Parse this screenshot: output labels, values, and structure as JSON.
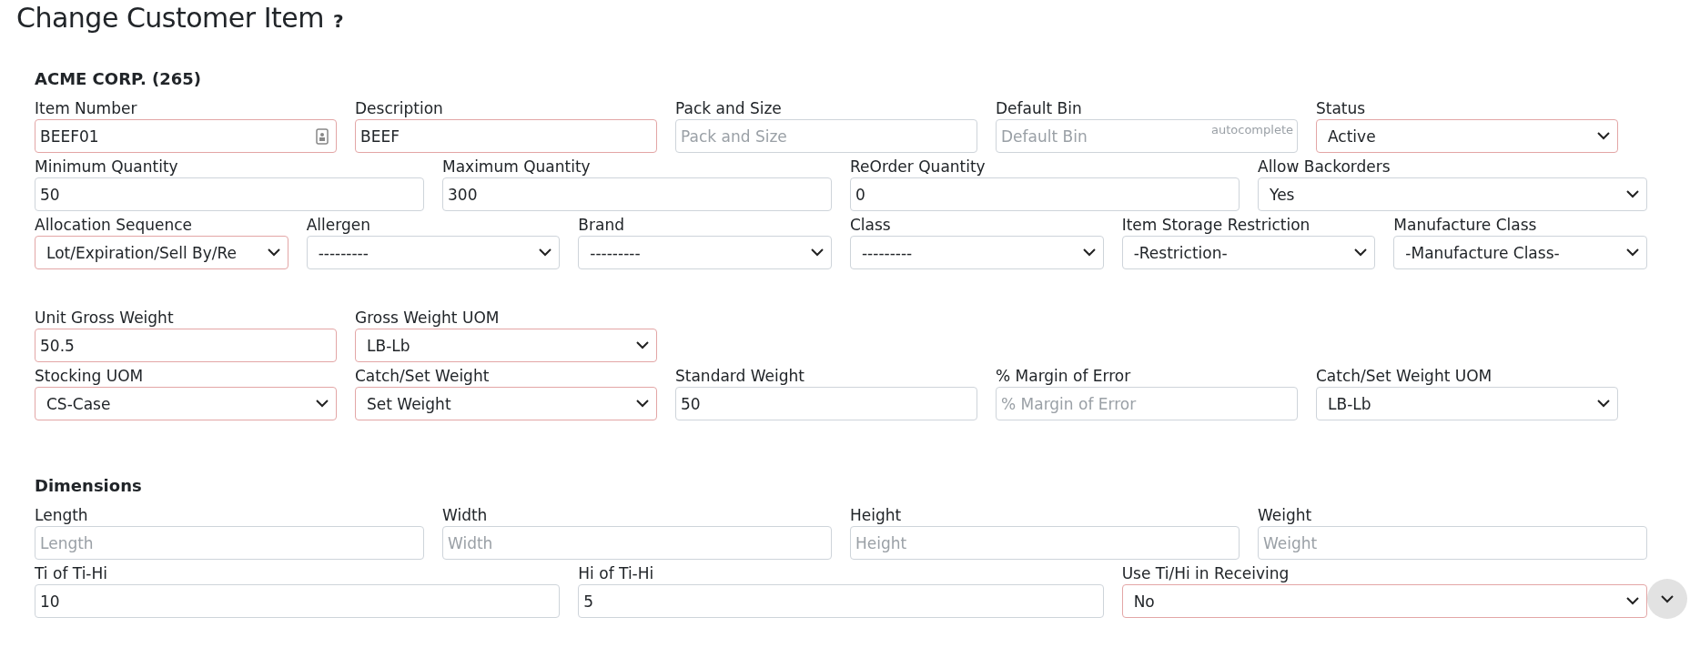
{
  "title": "Change Customer Item",
  "help": "?",
  "customer": "ACME CORP. (265)",
  "item_rows": [
    [
      {
        "label": "Item Number",
        "kind": "text",
        "value": "BEEF01",
        "required": true,
        "icon": true
      },
      {
        "label": "Description",
        "kind": "text",
        "value": "BEEF",
        "required": true
      },
      {
        "label": "Pack and Size",
        "kind": "text",
        "placeholder": "Pack and Size",
        "required": false
      },
      {
        "label": "Default Bin",
        "kind": "text",
        "placeholder": "Default Bin",
        "hint": "autocomplete",
        "required": false
      },
      {
        "label": "Status",
        "kind": "select",
        "value": "Active",
        "required": true
      }
    ],
    [
      {
        "label": "Minimum Quantity",
        "kind": "text",
        "value": "50",
        "required": false
      },
      {
        "label": "Maximum Quantity",
        "kind": "text",
        "value": "300",
        "required": false
      },
      {
        "label": "ReOrder Quantity",
        "kind": "text",
        "value": "0",
        "required": false
      },
      {
        "label": "Allow Backorders",
        "kind": "select",
        "value": "Yes",
        "required": false
      }
    ],
    [
      {
        "label": "Allocation Sequence",
        "kind": "select",
        "value": "Lot/Expiration/Sell By/Re",
        "required": true
      },
      {
        "label": "Allergen",
        "kind": "select",
        "value": "---------",
        "required": false
      },
      {
        "label": "Brand",
        "kind": "select",
        "value": "---------",
        "required": false
      },
      {
        "label": "Class",
        "kind": "select",
        "value": "---------",
        "required": false
      },
      {
        "label": "Item Storage Restriction",
        "kind": "select",
        "value": "-Restriction-",
        "required": false
      },
      {
        "label": "Manufacture Class",
        "kind": "select",
        "value": "-Manufacture Class-",
        "required": false
      }
    ]
  ],
  "weight_rows": [
    [
      {
        "label": "Unit Gross Weight",
        "kind": "text",
        "value": "50.5",
        "required": true
      },
      {
        "label": "Gross Weight UOM",
        "kind": "select",
        "value": "LB-Lb",
        "required": true
      }
    ],
    [
      {
        "label": "Stocking UOM",
        "kind": "select",
        "value": "CS-Case",
        "required": true
      },
      {
        "label": "Catch/Set Weight",
        "kind": "select",
        "value": "Set Weight",
        "required": true
      },
      {
        "label": "Standard Weight",
        "kind": "text",
        "value": "50",
        "required": false
      },
      {
        "label": "% Margin of Error",
        "kind": "text",
        "placeholder": "% Margin of Error",
        "required": false
      },
      {
        "label": "Catch/Set Weight UOM",
        "kind": "select",
        "value": "LB-Lb",
        "required": false
      }
    ]
  ],
  "dimensions": {
    "heading": "Dimensions",
    "rows": [
      [
        {
          "label": "Length",
          "kind": "text",
          "placeholder": "Length",
          "required": false
        },
        {
          "label": "Width",
          "kind": "text",
          "placeholder": "Width",
          "required": false
        },
        {
          "label": "Height",
          "kind": "text",
          "placeholder": "Height",
          "required": false
        },
        {
          "label": "Weight",
          "kind": "text",
          "placeholder": "Weight",
          "required": false
        }
      ],
      [
        {
          "label": "Ti of Ti-Hi",
          "kind": "text",
          "value": "10",
          "required": false
        },
        {
          "label": "Hi of Ti-Hi",
          "kind": "text",
          "value": "5",
          "required": false
        },
        {
          "label": "Use Ti/Hi in Receiving",
          "kind": "select",
          "value": "No",
          "required": true
        }
      ]
    ]
  }
}
